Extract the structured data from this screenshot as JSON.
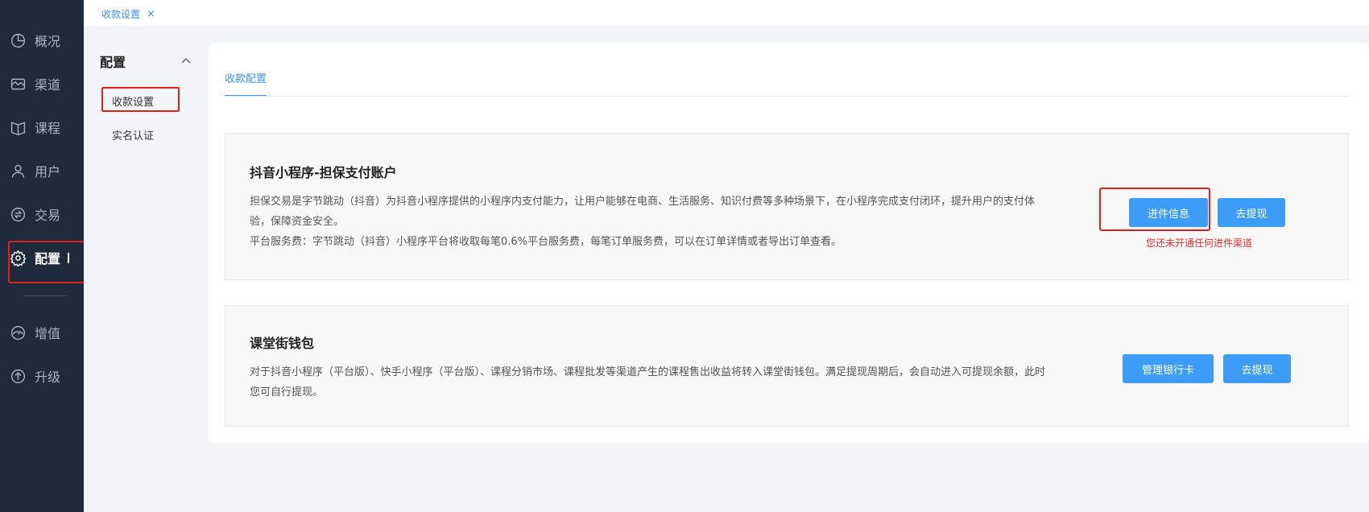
{
  "sidebar": {
    "items": [
      {
        "label": "概况",
        "icon": "pie-chart-icon"
      },
      {
        "label": "渠道",
        "icon": "store-icon"
      },
      {
        "label": "课程",
        "icon": "book-icon"
      },
      {
        "label": "用户",
        "icon": "user-icon"
      },
      {
        "label": "交易",
        "icon": "exchange-icon"
      },
      {
        "label": "配置",
        "icon": "gear-icon"
      },
      {
        "label": "增值",
        "icon": "gauge-icon"
      },
      {
        "label": "升级",
        "icon": "upgrade-icon"
      }
    ],
    "active": "配置"
  },
  "topbar": {
    "tab_label": "收款设置",
    "close": "×"
  },
  "submenu": {
    "title": "配置",
    "items": [
      "收款设置",
      "实名认证"
    ]
  },
  "main": {
    "tab": "收款配置",
    "douyin": {
      "title": "抖音小程序-担保支付账户",
      "desc1": "担保交易是字节跳动（抖音）为抖音小程序提供的小程序内支付能力，让用户能够在电商、生活服务、知识付费等多种场景下，在小程序完成支付闭环，提升用户的支付体验，保障资金安全。",
      "desc2": "平台服务费：字节跳动（抖音）小程序平台将收取每笔0.6%平台服务费，每笔订单服务费，可以在订单详情或者导出订单查看。",
      "btn_info": "进件信息",
      "btn_withdraw": "去提现",
      "warning": "您还未开通任何进件渠道"
    },
    "wallet": {
      "title": "课堂街钱包",
      "desc": "对于抖音小程序（平台版）、快手小程序（平台版）、课程分销市场、课程批发等渠道产生的课程售出收益将转入课堂街钱包。满足提现周期后，会自动进入可提现余额，此时您可自行提现。",
      "btn_bank": "管理银行卡",
      "btn_withdraw": "去提现"
    }
  },
  "colors": {
    "sidebar": "#1f2a3d",
    "accent": "#3d94f6",
    "button": "#3d9cf6",
    "warning": "#e03030",
    "highlight": "#e02020"
  }
}
